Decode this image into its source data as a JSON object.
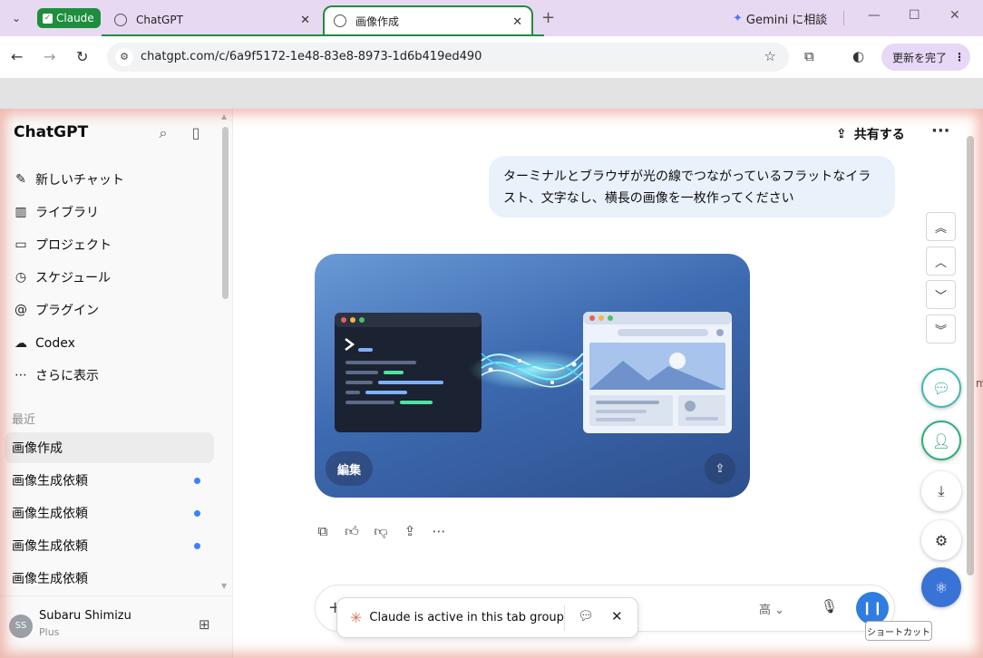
{
  "browser": {
    "tab_group_label": "Claude",
    "tabs": [
      {
        "title": "ChatGPT"
      },
      {
        "title": "画像作成"
      }
    ],
    "gemini_button": "Gemini に相談",
    "url": "chatgpt.com/c/6a9f5172-1e48-83e8-8973-1d6b419ed490",
    "update_button": "更新を完了",
    "colors": {
      "tab_group": "#1e8e3e",
      "tabstrip": "#e8d9f2",
      "update_button": "#e7d8f7"
    }
  },
  "sidebar": {
    "title": "ChatGPT",
    "nav": [
      {
        "label": "新しいチャット",
        "icon": "new-chat-icon"
      },
      {
        "label": "ライブラリ",
        "icon": "library-icon"
      },
      {
        "label": "プロジェクト",
        "icon": "folder-icon"
      },
      {
        "label": "スケジュール",
        "icon": "clock-icon"
      },
      {
        "label": "プラグイン",
        "icon": "at-icon"
      },
      {
        "label": "Codex",
        "icon": "codex-icon"
      },
      {
        "label": "さらに表示",
        "icon": "more-dots-icon"
      }
    ],
    "recent_label": "最近",
    "chats": [
      {
        "title": "画像作成",
        "active": true,
        "unread": false
      },
      {
        "title": "画像生成依頼",
        "active": false,
        "unread": true
      },
      {
        "title": "画像生成依頼",
        "active": false,
        "unread": true
      },
      {
        "title": "画像生成依頼",
        "active": false,
        "unread": true
      },
      {
        "title": "画像生成依頼",
        "active": false,
        "unread": false
      }
    ],
    "user": {
      "initials": "SS",
      "name": "Subaru Shimizu",
      "plan": "Plus"
    }
  },
  "main": {
    "share_label": "共有する",
    "user_message": "ターミナルとブラウザが光の線でつながっているフラットなイラスト、文字なし、横長の画像を一枚作ってください",
    "image_edit_label": "編集",
    "composer": {
      "quality_label": "高"
    },
    "colors": {
      "bubble": "#e9f1fb",
      "voice_button": "#2f7de1"
    }
  },
  "claude_bar": {
    "text": "Claude is active in this tab group",
    "accent": "#d97757"
  },
  "floating_tools": {
    "shortcut_tooltip": "ショートカット"
  },
  "edge_text": "m"
}
